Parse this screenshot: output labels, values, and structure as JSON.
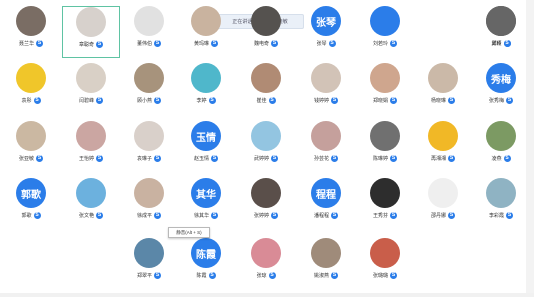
{
  "notice": "正在讲话: 章聪奇, 郭晓敏",
  "tooltip": "静音(Alt + S)",
  "badge": "S",
  "colors": {
    "brand": "#2b7de9",
    "selected": "#5fc3a3"
  },
  "participants": [
    {
      "name": "聂兰华",
      "text": "",
      "bg": "#7a6d64"
    },
    {
      "name": "章聪奇",
      "text": "",
      "bg": "#d7d1cc",
      "selected": true
    },
    {
      "name": "董伟伯",
      "text": "",
      "bg": "#e1e1e1"
    },
    {
      "name": "黄玛琳",
      "text": "",
      "bg": "#c9b39f"
    },
    {
      "name": "魏电奇",
      "text": "",
      "bg": "#55524f"
    },
    {
      "name": "张琴",
      "text": "张琴",
      "bg": "#2b7de9"
    },
    {
      "name": "刘若玲",
      "text": "",
      "bg": "#2b7de9"
    },
    {
      "name": "",
      "text": "",
      "bg": "#ffffff"
    },
    {
      "name": "邱颖",
      "text": "",
      "bg": "#4b4b4b"
    },
    {
      "name": "龚玲",
      "text": "",
      "bg": "#666666"
    },
    {
      "name": "袁彤",
      "text": "",
      "bg": "#f0c62a"
    },
    {
      "name": "闫碧峰",
      "text": "",
      "bg": "#d9d0c6"
    },
    {
      "name": "顾小燕",
      "text": "",
      "bg": "#a7937c"
    },
    {
      "name": "李婷",
      "text": "",
      "bg": "#4fb7cb"
    },
    {
      "name": "崔佳",
      "text": "",
      "bg": "#b08b74"
    },
    {
      "name": "钱婷婷",
      "text": "",
      "bg": "#d2c3b7"
    },
    {
      "name": "郑晓娟",
      "text": "",
      "bg": "#cfa68e"
    },
    {
      "name": "杨晓琳",
      "text": "",
      "bg": "#cbb9a8"
    },
    {
      "name": "张秀梅",
      "text": "秀梅",
      "bg": "#2b7de9"
    },
    {
      "name": "张亚敏",
      "text": "",
      "bg": "#cbb8a2"
    },
    {
      "name": "王怡婷",
      "text": "",
      "bg": "#cba6a2"
    },
    {
      "name": "袁琳子",
      "text": "",
      "bg": "#d9d0ca"
    },
    {
      "name": "赵玉情",
      "text": "玉情",
      "bg": "#2b7de9"
    },
    {
      "name": "武婷婷",
      "text": "",
      "bg": "#93c5e1"
    },
    {
      "name": "孙芸花",
      "text": "",
      "bg": "#c5a09c"
    },
    {
      "name": "陈琳婷",
      "text": "",
      "bg": "#707070"
    },
    {
      "name": "再湘湘",
      "text": "",
      "bg": "#f1b826"
    },
    {
      "name": "凌燕",
      "text": "",
      "bg": "#7c9a63"
    },
    {
      "name": "郭歌",
      "text": "郭歌",
      "bg": "#2b7de9"
    },
    {
      "name": "张文艳",
      "text": "",
      "bg": "#6cb1de"
    },
    {
      "name": "徐成平",
      "text": "",
      "bg": "#c9b2a1"
    },
    {
      "name": "徐其华",
      "text": "其华",
      "bg": "#2b7de9"
    },
    {
      "name": "张婷婷",
      "text": "",
      "bg": "#5a4f4a"
    },
    {
      "name": "潘程程",
      "text": "程程",
      "bg": "#2b7de9"
    },
    {
      "name": "王秀芬",
      "text": "",
      "bg": "#2d2d2d"
    },
    {
      "name": "邵丹娜",
      "text": "",
      "bg": "#efefef"
    },
    {
      "name": "李彩霞",
      "text": "",
      "bg": "#8fb3c3"
    },
    {
      "name": "郑翠平",
      "text": "",
      "bg": "#5b87a8"
    },
    {
      "name": "陈霞",
      "text": "陈霞",
      "bg": "#2b7de9"
    },
    {
      "name": "张琼",
      "text": "",
      "bg": "#d98b96"
    },
    {
      "name": "姚淑燕",
      "text": "",
      "bg": "#9f8b7a"
    },
    {
      "name": "张璐璐",
      "text": "",
      "bg": "#c95e4a"
    }
  ]
}
